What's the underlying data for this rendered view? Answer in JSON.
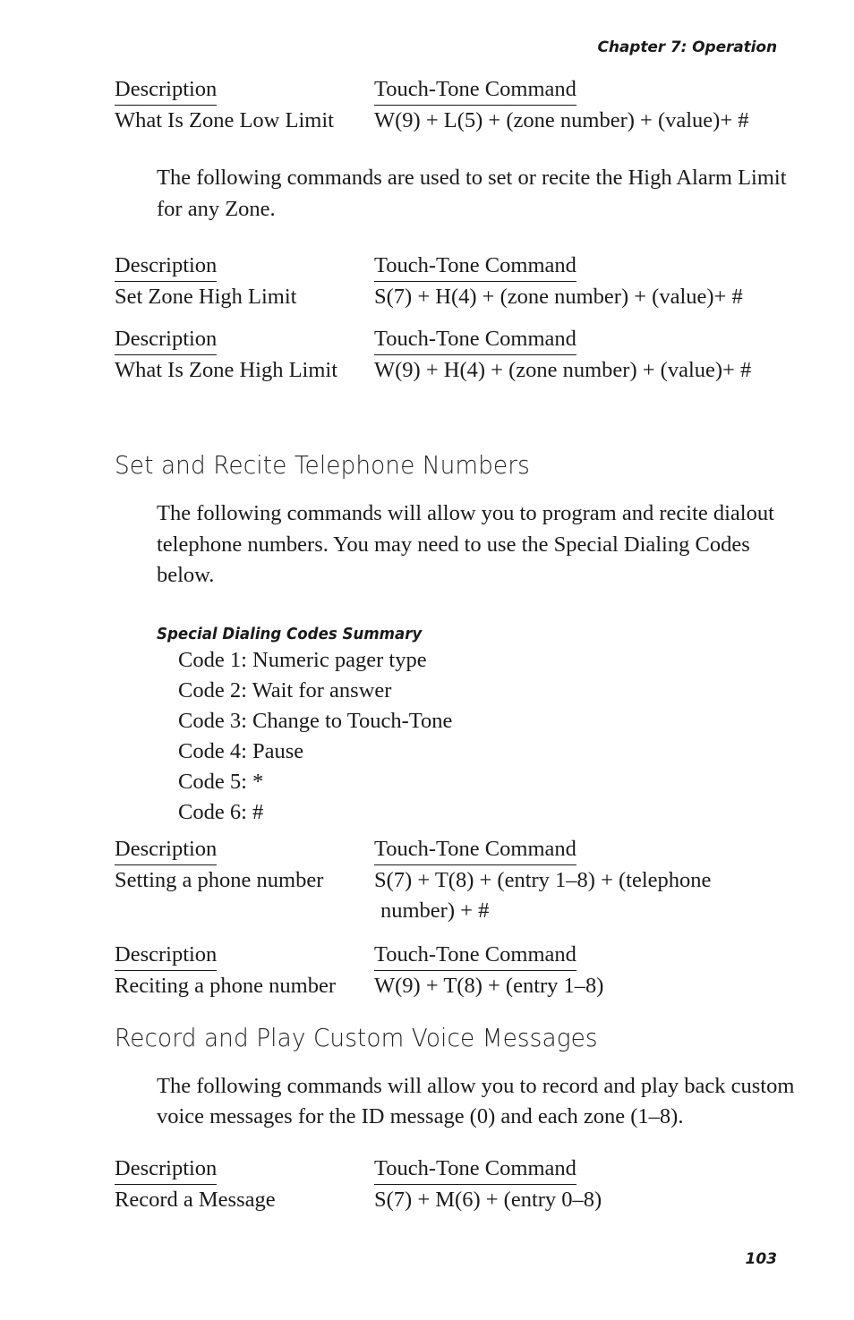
{
  "page": {
    "running_head": "Chapter 7: Operation",
    "folio": "103"
  },
  "labels": {
    "description": "Description",
    "touch_tone_command": "Touch-Tone Command",
    "touch_tone_command_trailing": "Touch-Tone Command "
  },
  "blocks": {
    "zone_low_limit": {
      "header_desc": "Description",
      "header_cmd": "Touch-Tone Command ",
      "desc": "What Is Zone Low Limit",
      "cmd": "W(9) + L(5) + (zone number) + (value)+ #"
    },
    "high_limit_intro": "The following commands are used to set or recite the High Alarm Limit for any Zone.",
    "set_zone_high": {
      "header_desc": "Description",
      "header_cmd": "Touch-Tone Command",
      "desc": "Set Zone High Limit",
      "cmd": "S(7) + H(4) + (zone number) + (value)+ #"
    },
    "what_is_zone_high": {
      "header_desc": "Description",
      "header_cmd": "Touch-Tone Command",
      "desc": "What Is Zone High Limit",
      "cmd": "W(9) + H(4) + (zone number) + (value)+ #"
    },
    "setting_phone": {
      "header_desc": "Description",
      "header_cmd": "Touch-Tone Command",
      "desc": "Setting a phone number",
      "cmd": "S(7) + T(8) + (entry 1–8) + (telephone",
      "cmd_cont": "number) + #"
    },
    "reciting_phone": {
      "header_desc": "Description",
      "header_cmd": "Touch-Tone Command",
      "desc": "Reciting a phone number",
      "cmd": "W(9) + T(8) + (entry 1–8)"
    },
    "record_message": {
      "header_desc": "Description",
      "header_cmd": "Touch-Tone Command",
      "desc": "Record a Message",
      "cmd": "S(7) + M(6) + (entry 0–8)"
    }
  },
  "sections": {
    "telephone": {
      "heading": "Set and Recite Telephone Numbers",
      "intro": "The following commands will allow you to program and recite dialout telephone numbers. You may need to use the Special Dialing Codes below.",
      "codes_subhead": "Special Dialing Codes Summary",
      "codes": [
        "Code 1: Numeric pager type",
        "Code 2: Wait for answer",
        "Code 3: Change to Touch-Tone",
        "Code 4: Pause",
        "Code 5: *",
        "Code 6: #"
      ]
    },
    "voice": {
      "heading": "Record and Play Custom Voice Messages",
      "intro": "The following commands will allow you to record and play back custom voice messages for the ID message (0) and each zone (1–8)."
    }
  }
}
